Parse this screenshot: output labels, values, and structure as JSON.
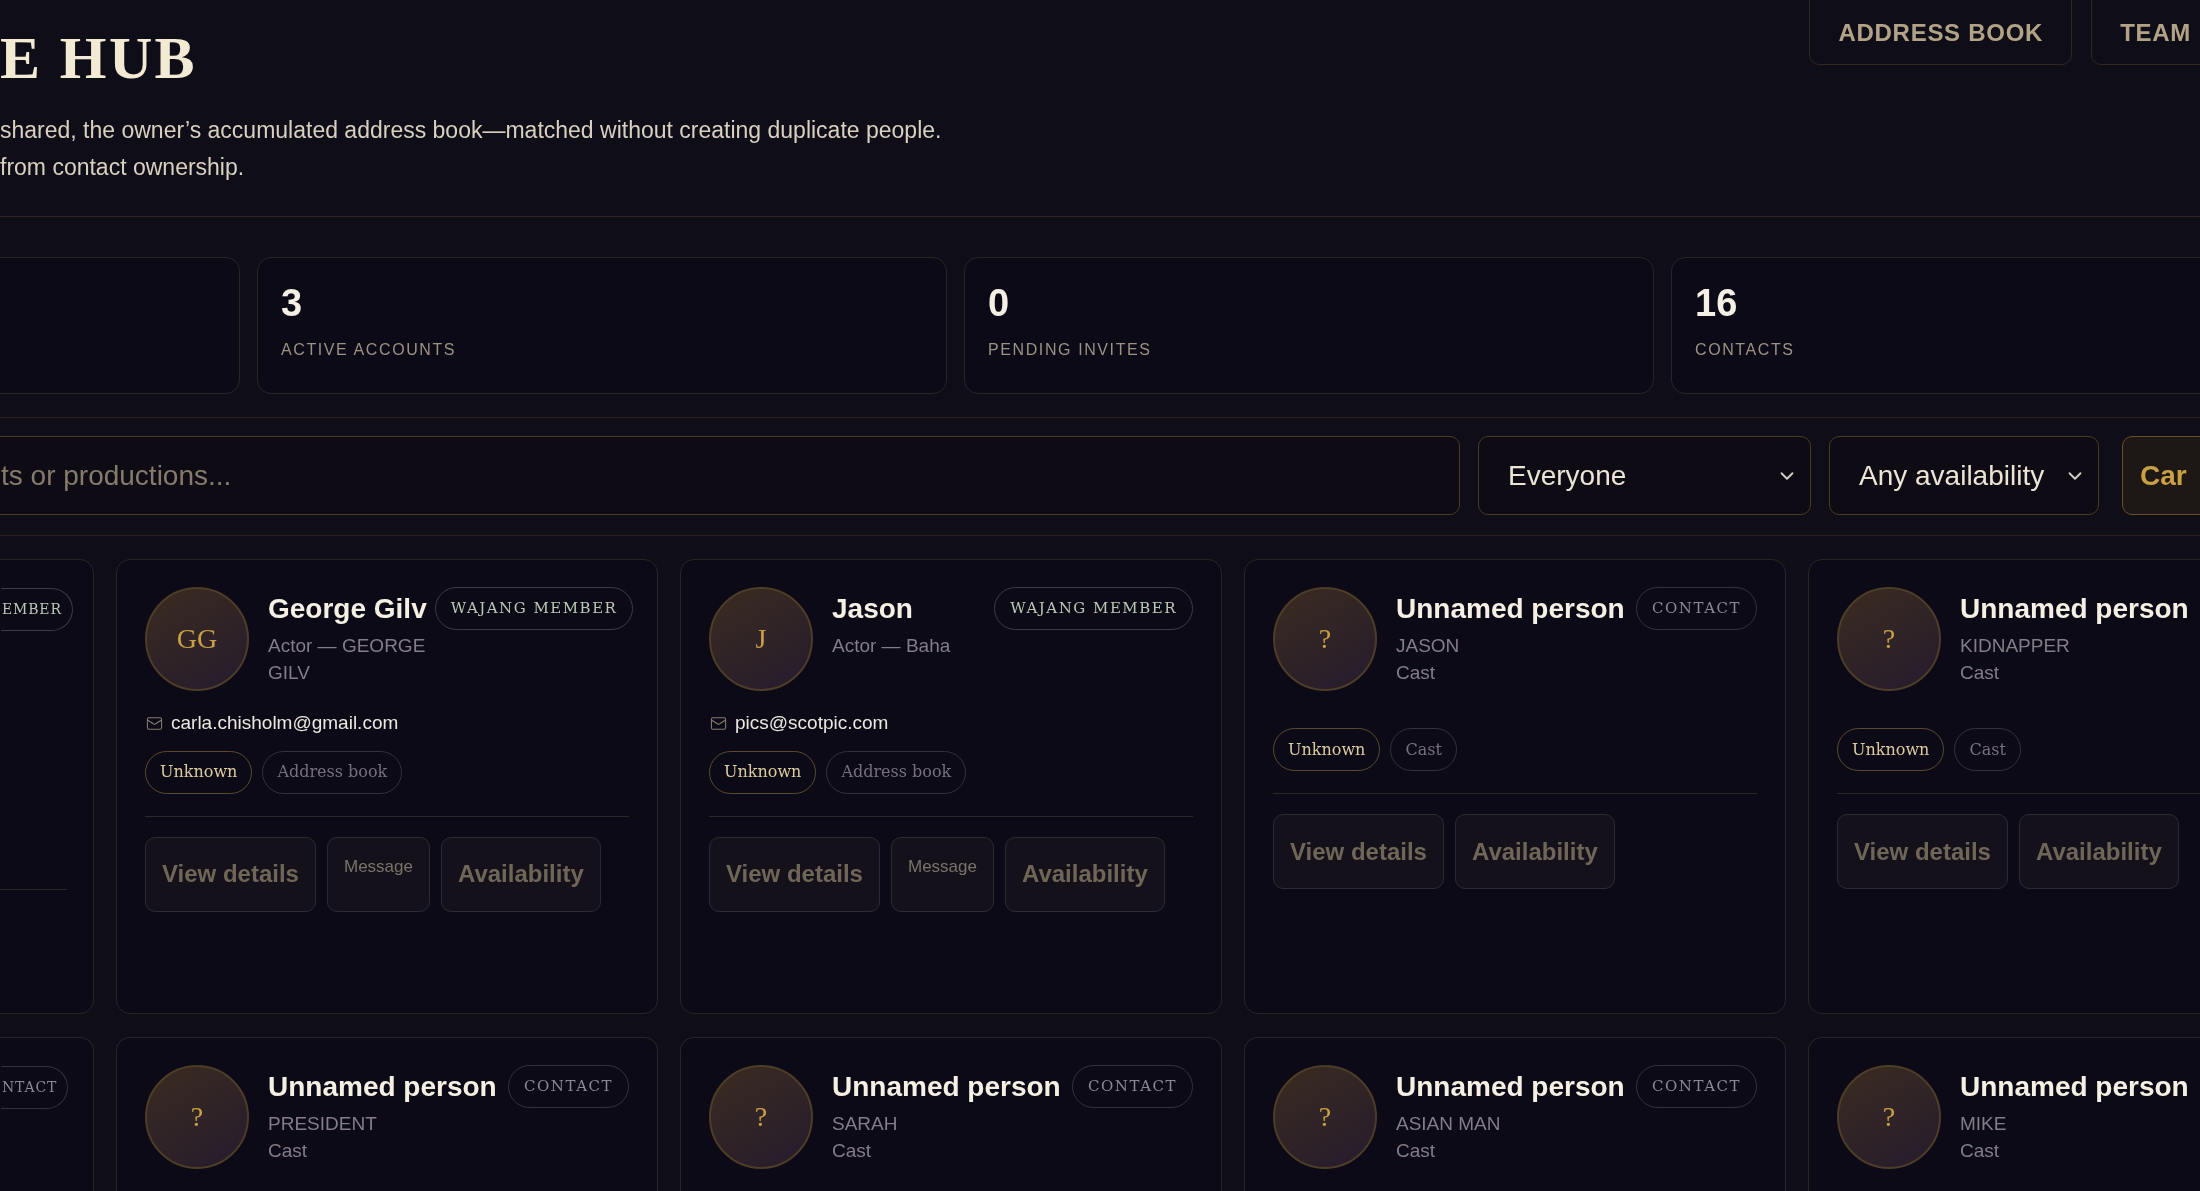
{
  "nav_buttons": [
    "ADDRESS BOOK",
    "TEAM"
  ],
  "header": {
    "title": "E HUB",
    "description_lines": [
      "shared, the owner’s accumulated address book—matched without creating duplicate people.",
      "from contact ownership."
    ]
  },
  "stats": [
    {
      "value": "3",
      "label": "ACTIVE ACCOUNTS"
    },
    {
      "value": "0",
      "label": "PENDING INVITES"
    },
    {
      "value": "16",
      "label": "CONTACTS"
    }
  ],
  "filters": {
    "search": {
      "placeholder": "ts or productions..."
    },
    "selects": [
      {
        "value": "Everyone"
      },
      {
        "value": "Any availability"
      }
    ],
    "button": "Car"
  },
  "card_rows": [
    [
      {
        "kind": "clipped",
        "badge": {
          "text": "EMBER",
          "kind": "member"
        },
        "divider": true
      },
      {
        "kind": "full",
        "initials": "GG",
        "name": "George Gilv",
        "badge": {
          "text": "WAJANG MEMBER",
          "kind": "member"
        },
        "role_lines": [
          "Actor — GEORGE",
          "GILV"
        ],
        "email": "carla.chisholm@gmail.com",
        "tags": [
          {
            "text": "Unknown",
            "kind": "status"
          },
          {
            "text": "Address book",
            "kind": "source"
          }
        ],
        "actions": [
          {
            "text": "View details",
            "kind": "large"
          },
          {
            "text": "Message",
            "kind": "small"
          },
          {
            "text": "Availability",
            "kind": "large"
          }
        ]
      },
      {
        "kind": "full",
        "initials": "J",
        "name": "Jason",
        "badge": {
          "text": "WAJANG MEMBER",
          "kind": "member"
        },
        "role_lines": [
          "Actor — Baha"
        ],
        "email": "pics@scotpic.com",
        "tags": [
          {
            "text": "Unknown",
            "kind": "status"
          },
          {
            "text": "Address book",
            "kind": "source"
          }
        ],
        "actions": [
          {
            "text": "View details",
            "kind": "large"
          },
          {
            "text": "Message",
            "kind": "small"
          },
          {
            "text": "Availability",
            "kind": "large"
          }
        ]
      },
      {
        "kind": "full",
        "initials": "?",
        "name": "Unnamed person",
        "badge": {
          "text": "CONTACT",
          "kind": "contact"
        },
        "role_lines": [
          "JASON",
          "Cast"
        ],
        "tags": [
          {
            "text": "Unknown",
            "kind": "status"
          },
          {
            "text": "Cast",
            "kind": "source"
          }
        ],
        "actions": [
          {
            "text": "View details",
            "kind": "large"
          },
          {
            "text": "Availability",
            "kind": "large"
          }
        ]
      },
      {
        "kind": "full",
        "initials": "?",
        "name": "Unnamed person",
        "role_lines": [
          "KIDNAPPER",
          "Cast"
        ],
        "tags": [
          {
            "text": "Unknown",
            "kind": "status"
          },
          {
            "text": "Cast",
            "kind": "source"
          }
        ],
        "actions": [
          {
            "text": "View details",
            "kind": "large"
          },
          {
            "text": "Availability",
            "kind": "large"
          }
        ]
      }
    ],
    [
      {
        "kind": "clipped",
        "badge": {
          "text": "NTACT",
          "kind": "contact"
        },
        "divider": false
      },
      {
        "kind": "full",
        "initials": "?",
        "name": "Unnamed person",
        "badge": {
          "text": "CONTACT",
          "kind": "contact"
        },
        "role_lines": [
          "PRESIDENT",
          "Cast"
        ]
      },
      {
        "kind": "full",
        "initials": "?",
        "name": "Unnamed person",
        "badge": {
          "text": "CONTACT",
          "kind": "contact"
        },
        "role_lines": [
          "SARAH",
          "Cast"
        ]
      },
      {
        "kind": "full",
        "initials": "?",
        "name": "Unnamed person",
        "badge": {
          "text": "CONTACT",
          "kind": "contact"
        },
        "role_lines": [
          "ASIAN MAN",
          "Cast"
        ]
      },
      {
        "kind": "full",
        "initials": "?",
        "name": "Unnamed person",
        "role_lines": [
          "MIKE",
          "Cast"
        ]
      }
    ]
  ]
}
